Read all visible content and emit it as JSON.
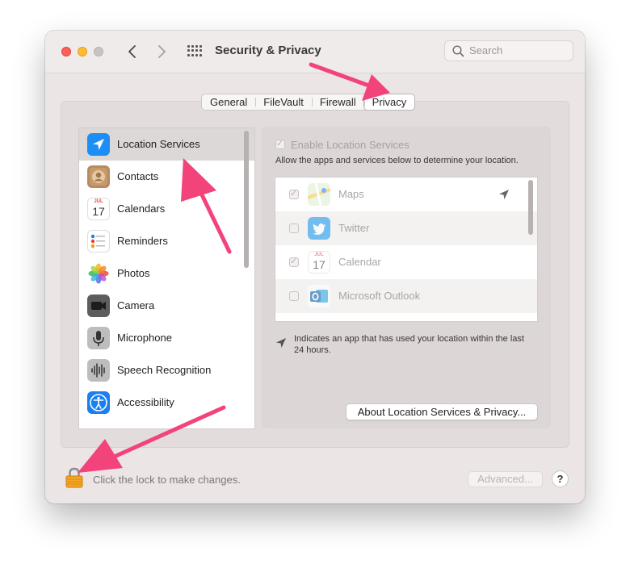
{
  "window": {
    "title": "Security & Privacy",
    "search_placeholder": "Search"
  },
  "tabs": [
    {
      "label": "General"
    },
    {
      "label": "FileVault"
    },
    {
      "label": "Firewall"
    },
    {
      "label": "Privacy",
      "active": true
    }
  ],
  "sidebar": {
    "items": [
      {
        "label": "Location Services",
        "icon": "location-icon",
        "selected": true
      },
      {
        "label": "Contacts",
        "icon": "contacts-icon"
      },
      {
        "label": "Calendars",
        "icon": "calendar-icon"
      },
      {
        "label": "Reminders",
        "icon": "reminders-icon"
      },
      {
        "label": "Photos",
        "icon": "photos-icon"
      },
      {
        "label": "Camera",
        "icon": "camera-icon"
      },
      {
        "label": "Microphone",
        "icon": "microphone-icon"
      },
      {
        "label": "Speech Recognition",
        "icon": "speech-recognition-icon"
      },
      {
        "label": "Accessibility",
        "icon": "accessibility-icon"
      }
    ]
  },
  "location": {
    "enable_label": "Enable Location Services",
    "enable_checked": true,
    "allow_text": "Allow the apps and services below to determine your location.",
    "apps": [
      {
        "name": "Maps",
        "checked": true,
        "recent_use": true
      },
      {
        "name": "Twitter",
        "checked": false
      },
      {
        "name": "Calendar",
        "checked": true,
        "calendar_month": "JUL",
        "calendar_day": "17"
      },
      {
        "name": "Microsoft Outlook",
        "checked": false
      }
    ],
    "note": "Indicates an app that has used your location within the last 24 hours.",
    "about_button": "About Location Services & Privacy..."
  },
  "footer": {
    "lock_text": "Click the lock to make changes.",
    "advanced_button": "Advanced...",
    "help_button": "?"
  },
  "colors": {
    "annotation_arrow": "#f2437a",
    "close": "#fe5f57",
    "minimize": "#febc2e"
  },
  "calendar_icon": {
    "month": "JUL",
    "day": "17"
  }
}
